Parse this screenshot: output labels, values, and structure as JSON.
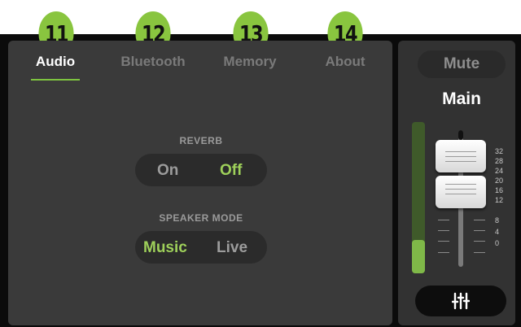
{
  "callouts": [
    "11",
    "12",
    "13",
    "14"
  ],
  "tabs": [
    {
      "label": "Audio",
      "active": true
    },
    {
      "label": "Bluetooth",
      "active": false
    },
    {
      "label": "Memory",
      "active": false
    },
    {
      "label": "About",
      "active": false
    }
  ],
  "reverb": {
    "label": "REVERB",
    "options": [
      "On",
      "Off"
    ],
    "selected": "Off"
  },
  "speaker_mode": {
    "label": "SPEAKER MODE",
    "options": [
      "Music",
      "Live"
    ],
    "selected": "Music"
  },
  "channel": {
    "mute_label": "Mute",
    "name": "Main",
    "meter_level": 0.22,
    "scale": [
      "32",
      "28",
      "24",
      "20",
      "16",
      "12",
      "8",
      "4",
      "0"
    ],
    "settings_icon": "sliders-icon"
  },
  "colors": {
    "accent_green": "#89c53f",
    "selected_text": "#9ed05a",
    "panel": "#3a3a3a"
  }
}
